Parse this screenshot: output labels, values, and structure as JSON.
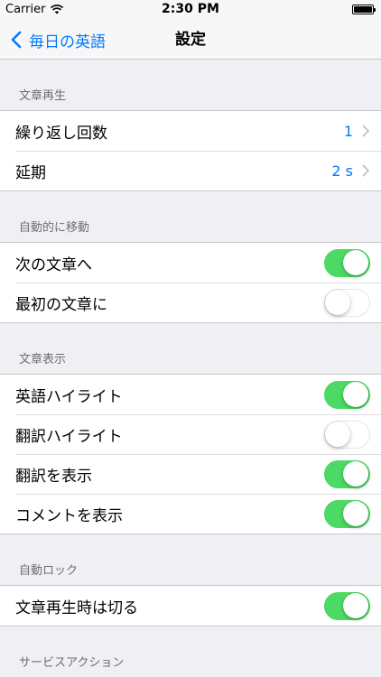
{
  "status_bar": {
    "carrier": "Carrier",
    "time": "2:30 PM"
  },
  "nav": {
    "back_label": "毎日の英語",
    "title": "設定"
  },
  "colors": {
    "accent": "#007aff",
    "toggle_on": "#4cd964"
  },
  "sections": [
    {
      "header": "文章再生",
      "rows": [
        {
          "label": "繰り返し回数",
          "value": "1"
        },
        {
          "label": "延期",
          "value": "2 s"
        }
      ]
    },
    {
      "header": "自動的に移動",
      "rows": [
        {
          "label": "次の文章へ",
          "on": true
        },
        {
          "label": "最初の文章に",
          "on": false
        }
      ]
    },
    {
      "header": "文章表示",
      "rows": [
        {
          "label": "英語ハイライト",
          "on": true
        },
        {
          "label": "翻訳ハイライト",
          "on": false
        },
        {
          "label": "翻訳を表示",
          "on": true
        },
        {
          "label": "コメントを表示",
          "on": true
        }
      ]
    },
    {
      "header": "自動ロック",
      "rows": [
        {
          "label": "文章再生時は切る",
          "on": true
        }
      ]
    },
    {
      "header": "サービスアクション",
      "rows": []
    }
  ]
}
